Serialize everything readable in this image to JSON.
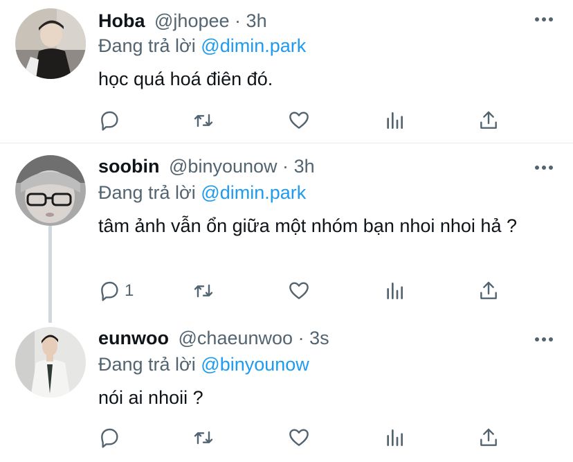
{
  "tweets": [
    {
      "name": "Hoba",
      "handle": "@jhopee",
      "dot": "·",
      "time": "3h",
      "reply_prefix": "Đang trả lời",
      "reply_to": "@dimin.park",
      "text": "học quá hoá điên đó.",
      "reply_count": ""
    },
    {
      "name": "soobin",
      "handle": "@binyounow",
      "dot": "·",
      "time": "3h",
      "reply_prefix": "Đang trả lời",
      "reply_to": "@dimin.park",
      "text": "tâm ảnh vẫn ổn giữa một nhóm bạn nhoi nhoi hả ?",
      "reply_count": "1"
    },
    {
      "name": "eunwoo",
      "handle": "@chaeunwoo",
      "dot": "·",
      "time": "3s",
      "reply_prefix": "Đang trả lời",
      "reply_to": "@binyounow",
      "text": "nói ai nhoii ?",
      "reply_count": ""
    }
  ],
  "icons": {
    "reply": "reply-icon",
    "retweet": "retweet-icon",
    "like": "heart-icon",
    "analytics": "analytics-icon",
    "share": "share-icon",
    "more": "more-icon"
  },
  "colors": {
    "mention": "#1d9bf0",
    "secondary_text": "#536471",
    "thread_line": "#cfd9de"
  }
}
